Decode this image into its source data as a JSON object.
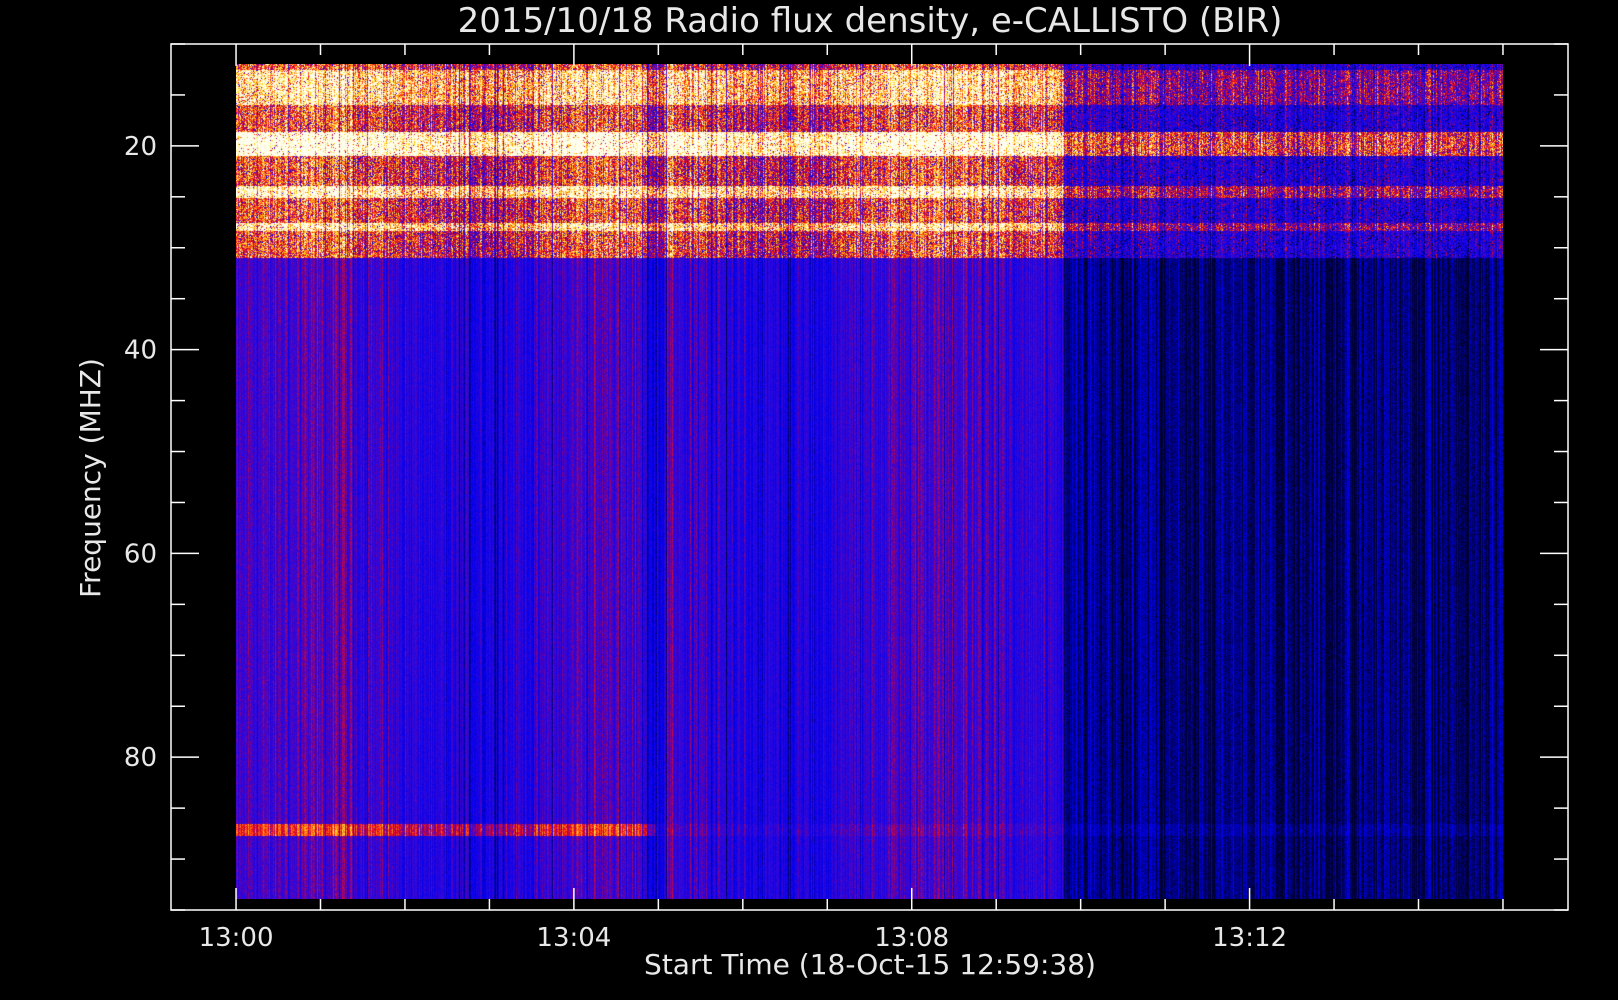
{
  "chart_data": {
    "type": "heatmap",
    "title": "2015/10/18  Radio flux density, e-CALLISTO (BIR)",
    "xlabel": "Start Time (18-Oct-15 12:59:38)",
    "ylabel": "Frequency (MHZ)",
    "x_ticks": [
      "13:00",
      "13:04",
      "13:08",
      "13:12"
    ],
    "x_tick_minutes": [
      0,
      4,
      8,
      12
    ],
    "xlim_minutes": [
      -0.77,
      15.77
    ],
    "data_x_range_minutes": [
      0,
      15
    ],
    "minor_x_step_minutes": 1,
    "y_ticks": [
      "20",
      "40",
      "60",
      "80"
    ],
    "y_tick_values": [
      20,
      40,
      60,
      80
    ],
    "ylim": [
      95,
      10
    ],
    "data_y_range": [
      12,
      94
    ],
    "minor_y_step": 5,
    "colormap": [
      "#000000",
      "#1010ff",
      "#ff1010",
      "#ffff40",
      "#ffffff"
    ],
    "background_color": "#000000",
    "axis_color": "#ffffff"
  }
}
